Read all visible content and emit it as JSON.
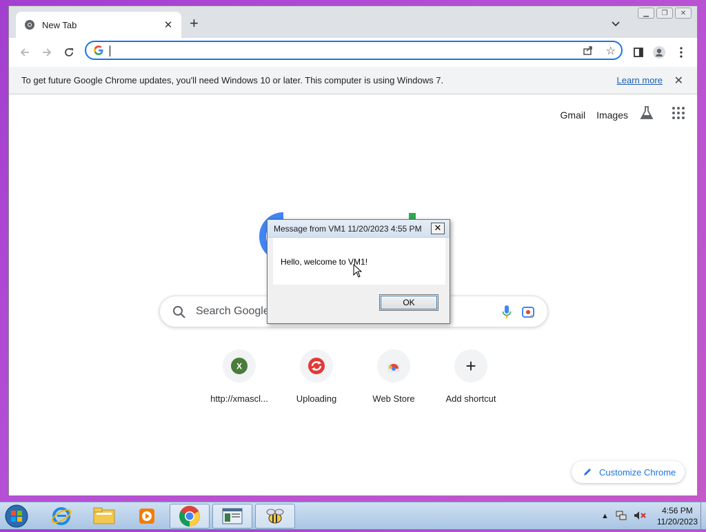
{
  "browser": {
    "tab_title": "New Tab",
    "tab_close": "✕",
    "new_tab": "+",
    "omnibox_value": "",
    "infobar_text": "To get future Google Chrome updates, you'll need Windows 10 or later. This computer is using Windows 7.",
    "infobar_link": "Learn more",
    "infobar_close": "✕"
  },
  "newtab": {
    "nav": {
      "gmail": "Gmail",
      "images": "Images"
    },
    "search_placeholder": "Search Google",
    "shortcuts": [
      {
        "label": "http://xmascl...",
        "icon": "x-site-icon"
      },
      {
        "label": "Uploading",
        "icon": "uploading-icon"
      },
      {
        "label": "Web Store",
        "icon": "webstore-icon"
      },
      {
        "label": "Add shortcut",
        "icon": "plus-icon"
      }
    ],
    "shortcut_x_letter": "X",
    "add_plus": "+",
    "customize_label": "Customize Chrome"
  },
  "dialog": {
    "title": "Message from VM1 11/20/2023 4:55 PM",
    "close": "✕",
    "message": "Hello, welcome to VM1!",
    "ok_label": "OK"
  },
  "taskbar": {
    "time": "4:56 PM",
    "date": "11/20/2023",
    "items": [
      "internet-explorer-icon",
      "file-explorer-icon",
      "media-player-icon",
      "chrome-icon",
      "vm-window-icon",
      "bee-app-icon"
    ]
  },
  "colors": {
    "desktop_bg": "#b44fd6",
    "accent": "#1a73e8",
    "google_blue": "#4285f4",
    "google_green": "#34a853"
  }
}
